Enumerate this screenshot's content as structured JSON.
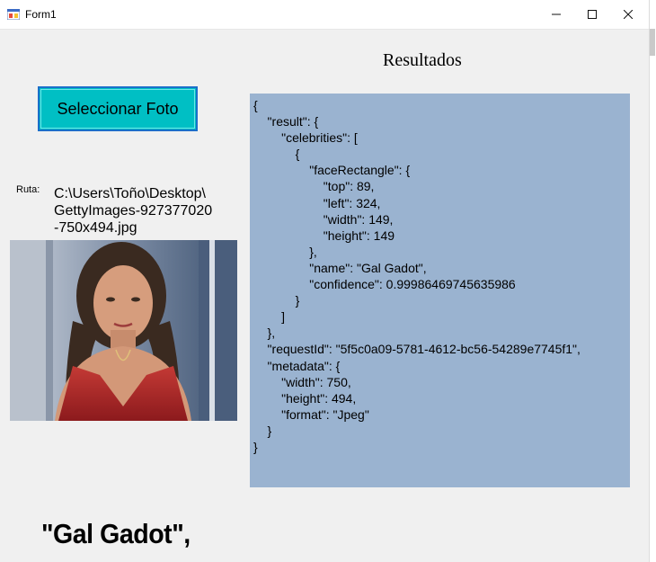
{
  "window": {
    "title": "Form1",
    "minimize_icon": "minimize-icon",
    "maximize_icon": "maximize-icon",
    "close_icon": "close-icon"
  },
  "select_button": {
    "label": "Seleccionar Foto",
    "color": "#00bfc4"
  },
  "path": {
    "label": "Ruta:",
    "value": "C:\\Users\\Toño\\Desktop\\\nGettyImages-927377020\n-750x494.jpg"
  },
  "photo": {
    "description": "portrait-photo"
  },
  "results": {
    "title": "Resultados",
    "background": "#9ab3d0",
    "lines": [
      "{",
      "    \"result\": {",
      "        \"celebrities\": [",
      "            {",
      "                \"faceRectangle\": {",
      "                    \"top\": 89,",
      "                    \"left\": 324,",
      "                    \"width\": 149,",
      "                    \"height\": 149",
      "                },",
      "                \"name\": \"Gal Gadot\",",
      "                \"confidence\": 0.99986469745635986",
      "            }",
      "        ]",
      "    },",
      "    \"requestId\": \"5f5c0a09-5781-4612-bc56-54289e7745f1\",",
      "    \"metadata\": {",
      "        \"width\": 750,",
      "        \"height\": 494,",
      "        \"format\": \"Jpeg\"",
      "    }",
      "}"
    ]
  },
  "result_name": "\"Gal Gadot\","
}
